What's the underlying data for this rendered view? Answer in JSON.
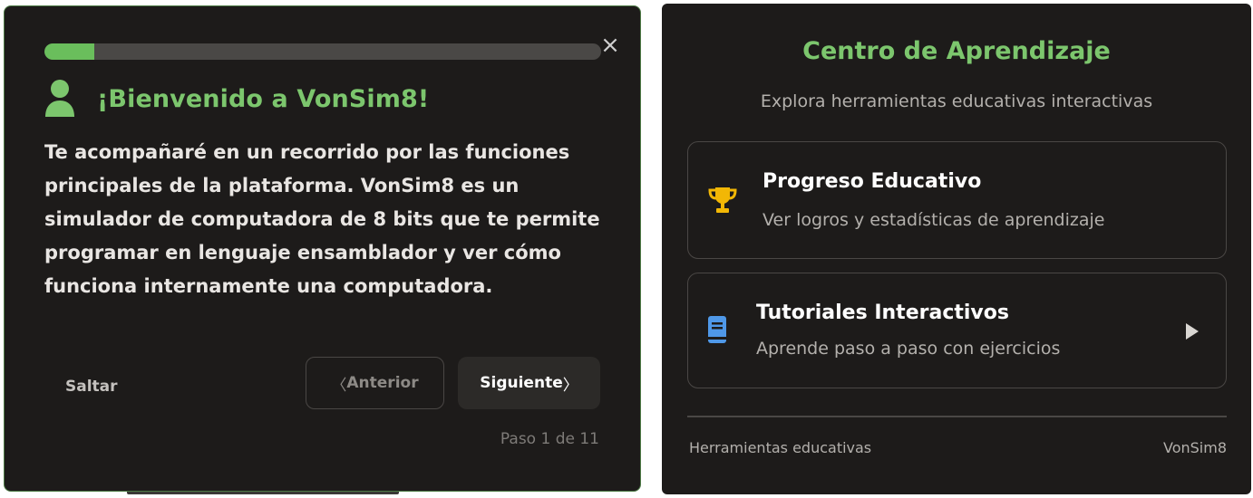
{
  "tour": {
    "progress_fraction": 0.09,
    "close_label": "×",
    "title": "¡Bienvenido a VonSim8!",
    "body": "Te acompañaré en un recorrido por las funciones principales de la plataforma. VonSim8 es un simulador de computadora de 8 bits que te permite programar en lenguaje ensamblador y ver cómo funciona internamente una computadora.",
    "skip_label": "Saltar",
    "prev_label": "Anterior",
    "next_label": "Siguiente",
    "step_label": "Paso 1 de 11",
    "colors": {
      "accent": "#7cc66d",
      "border": "#4d7a45",
      "background": "#1d1b1a"
    },
    "icons": {
      "header": "user-icon",
      "close": "close-icon",
      "prev": "chevron-left-icon",
      "next": "chevron-right-icon"
    }
  },
  "center": {
    "title": "Centro de Aprendizaje",
    "subtitle": "Explora herramientas educativas interactivas",
    "cards": [
      {
        "title": "Progreso Educativo",
        "description": "Ver logros y estadísticas de aprendizaje",
        "icon": "trophy-icon",
        "icon_color": "#f2b705"
      },
      {
        "title": "Tutoriales Interactivos",
        "description": "Aprende paso a paso con ejercicios",
        "icon": "book-icon",
        "icon_color": "#4f98e8",
        "trailing_icon": "play-icon"
      }
    ],
    "footer": {
      "left": "Herramientas educativas",
      "right": "VonSim8"
    }
  }
}
